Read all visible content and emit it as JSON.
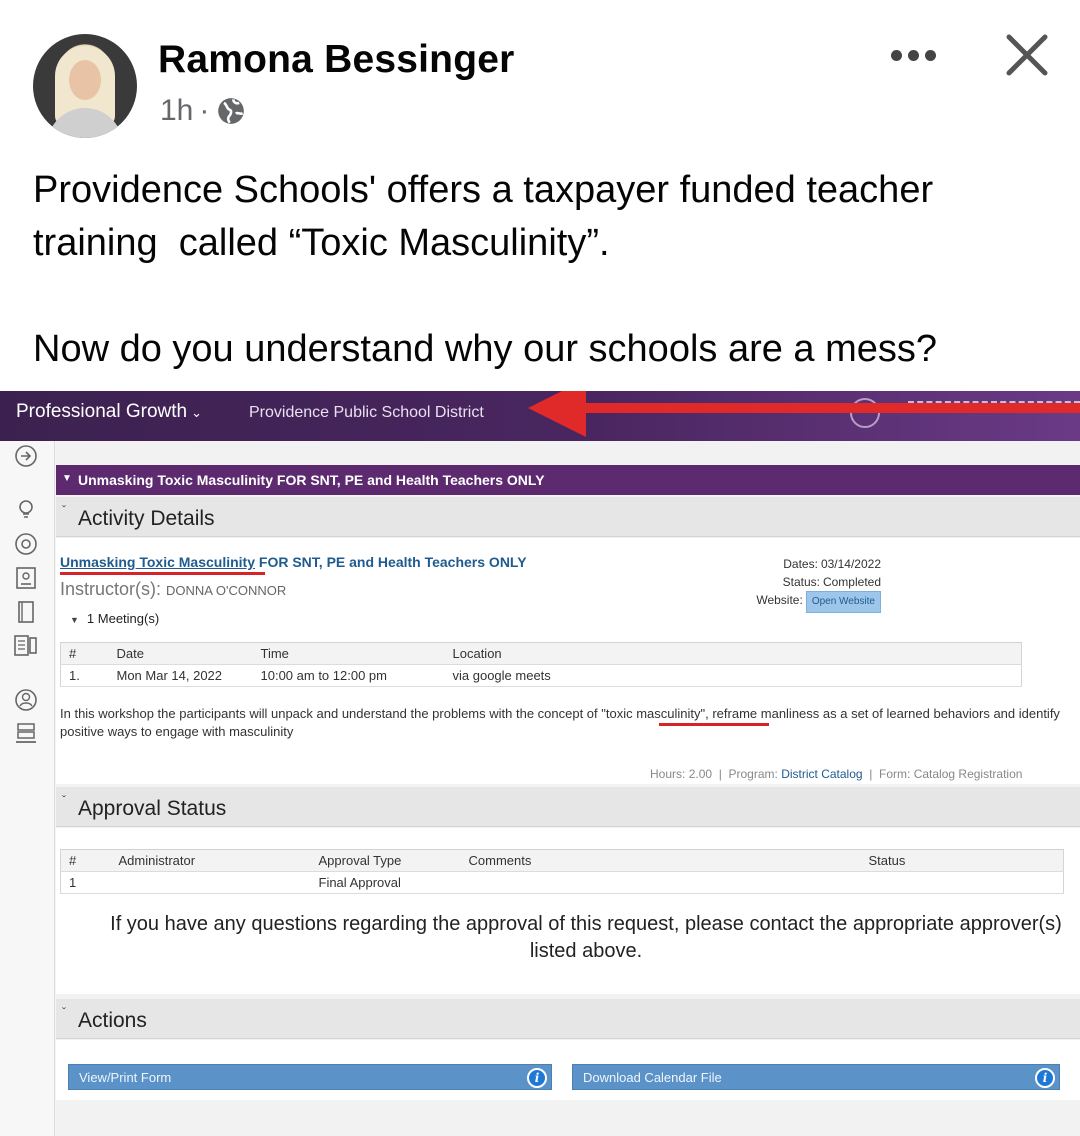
{
  "post": {
    "author": "Ramona Bessinger",
    "time": "1h",
    "separator": "·",
    "text_p1": "Providence Schools' offers a taxpayer funded teacher training  called “Toxic Masculinity”.",
    "text_p2": "Now do you understand why our schools are a mess?"
  },
  "app": {
    "brand": "Professional Growth",
    "brand_caret": "⌄",
    "district": "Providence Public School District"
  },
  "course": {
    "bar_title": "Unmasking Toxic Masculinity FOR SNT, PE and Health Teachers ONLY",
    "section_activity": "Activity Details",
    "link_part1": "Unmasking Toxic Masculinity",
    "link_part2": " FOR SNT, PE and Health Teachers ONLY",
    "instructor_label": "Instructor(s):",
    "instructor_name": "DONNA O'CONNOR",
    "dates_label": "Dates:",
    "dates_value": "03/14/2022",
    "status_label": "Status:",
    "status_value": "Completed",
    "website_label": "Website:",
    "website_button": "Open Website",
    "meetings_label": "1 Meeting(s)",
    "meeting_table": {
      "headers": [
        "#",
        "Date",
        "Time",
        "Location"
      ],
      "rows": [
        [
          "1.",
          "Mon Mar 14, 2022",
          "10:00 am to 12:00 pm",
          "via google meets"
        ]
      ]
    },
    "desc_part1": "In this workshop the participants will unpack and understand the problems with the concept of \"",
    "desc_highlight": "toxic masculinity",
    "desc_part2": "\", reframe manliness as a set of learned behaviors and identify positive ways to engage with masculinity",
    "hours_label": "Hours:",
    "hours_value": "2.00",
    "program_label": "Program:",
    "program_value": "District Catalog",
    "form_label": "Form:",
    "form_value": "Catalog Registration"
  },
  "approval": {
    "section_label": "Approval Status",
    "table": {
      "headers": [
        "#",
        "Administrator",
        "Approval Type",
        "Comments",
        "Status"
      ],
      "rows": [
        [
          "1",
          "",
          "Final Approval",
          "",
          ""
        ]
      ]
    },
    "note": "If you have any questions regarding the approval of this request, please contact the appropriate approver(s) listed above."
  },
  "actions": {
    "section_label": "Actions",
    "view_print": "View/Print Form",
    "download_calendar": "Download Calendar File",
    "info_glyph": "i"
  },
  "colors": {
    "topbar": "#4a2660",
    "purple_bar": "#5e2a6f",
    "link": "#1f5b8e",
    "annotation_red": "#d9232a",
    "button_blue": "#5b93c8"
  }
}
